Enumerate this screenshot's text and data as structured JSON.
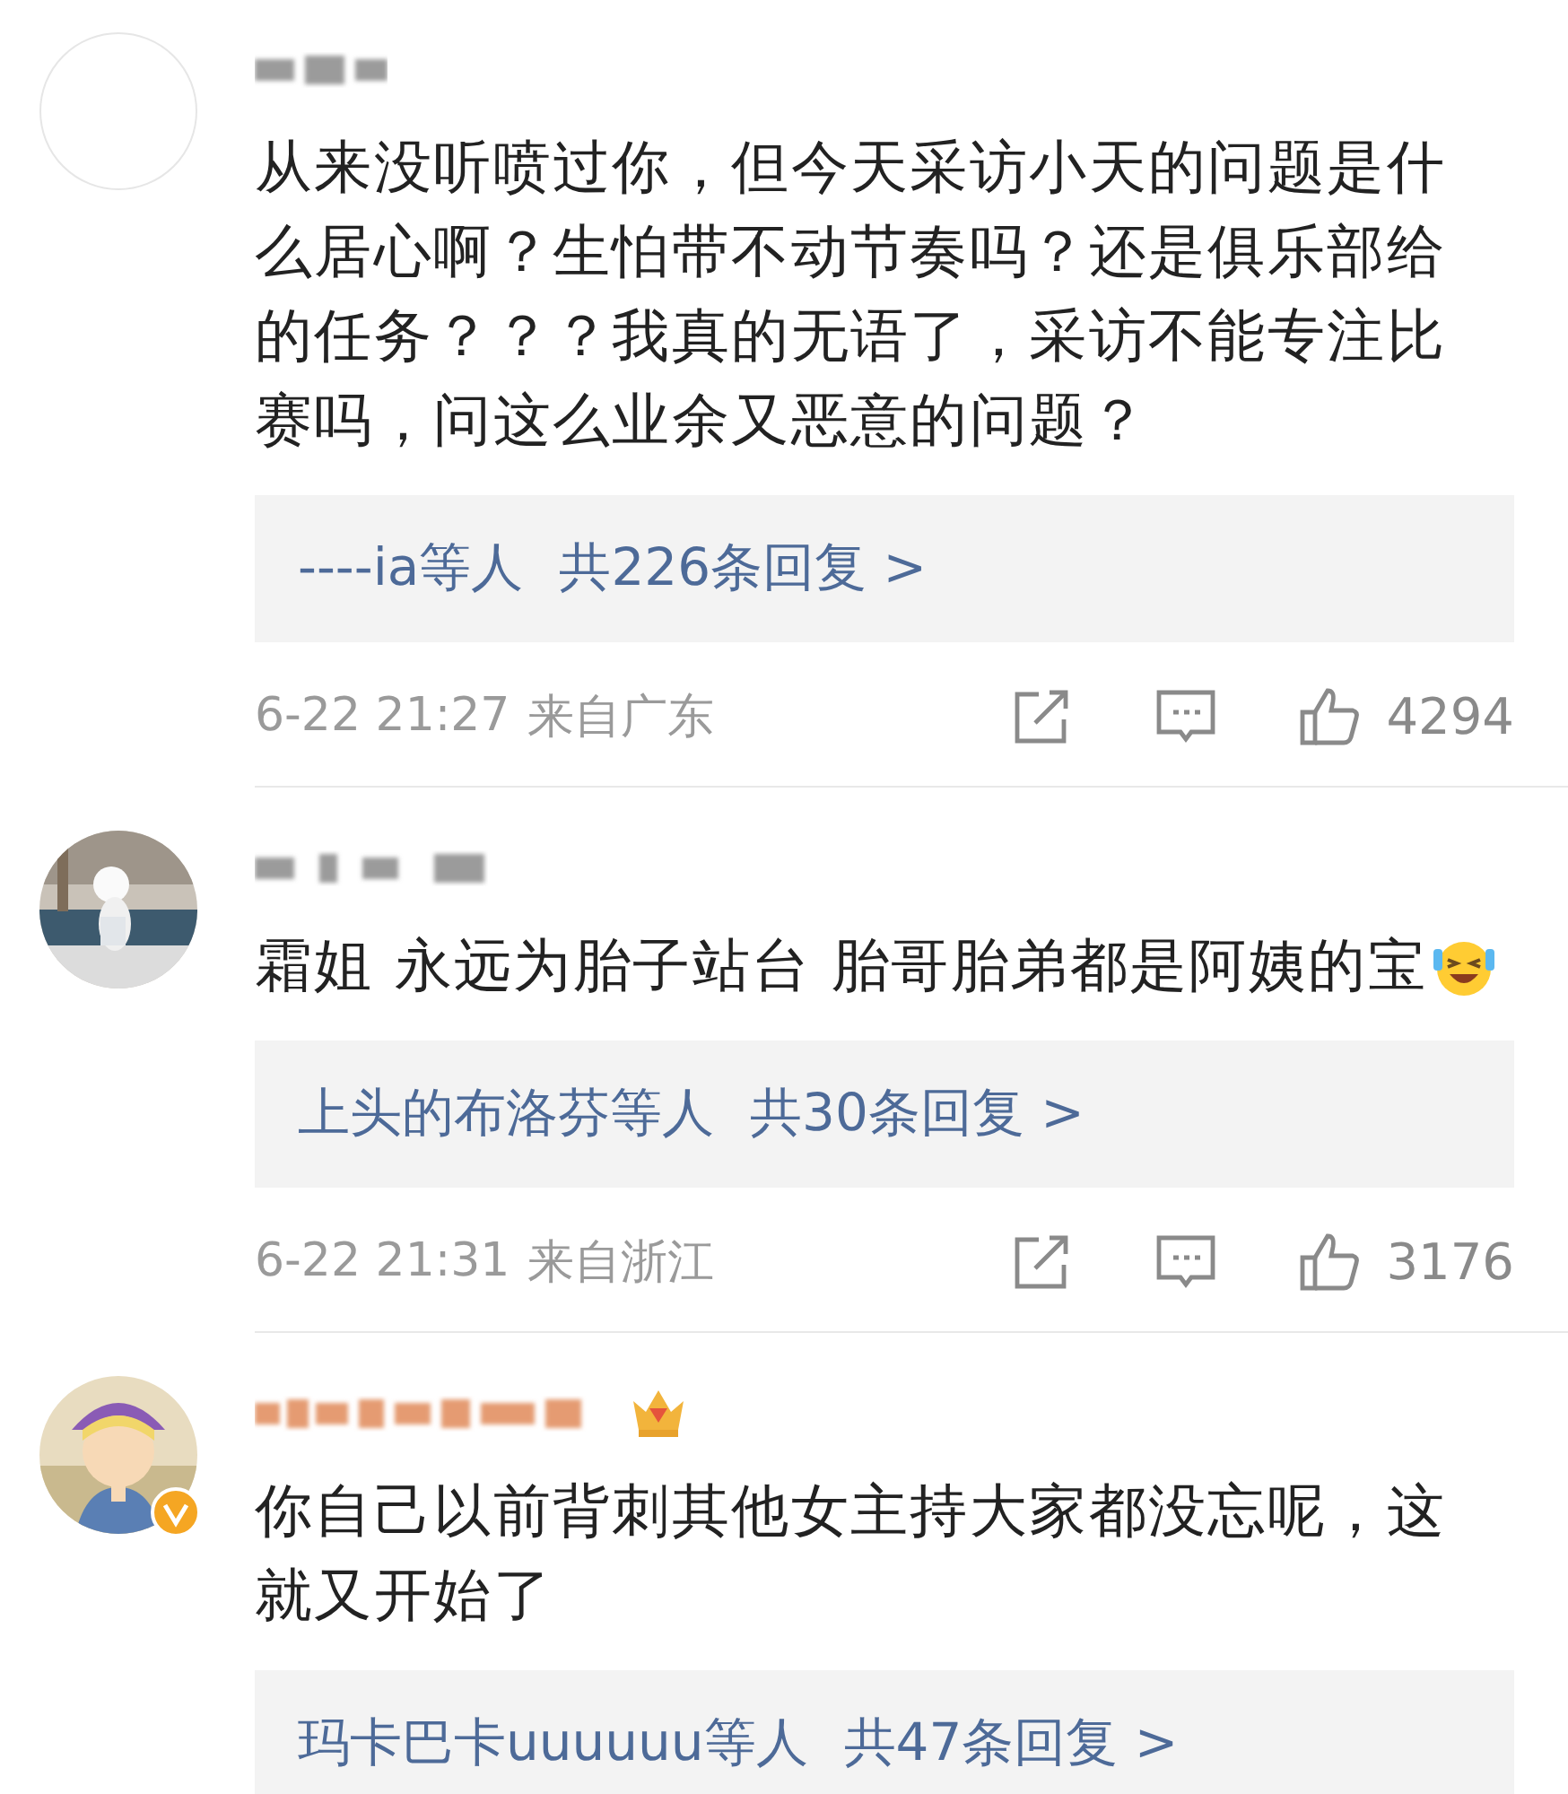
{
  "comments": [
    {
      "avatar": {
        "kind": "blank"
      },
      "vip": false,
      "verified": false,
      "text": "从来没听喷过你，但今天采访小天的问题是什么居心啊？生怕带不动节奏吗？还是俱乐部给的任务？？？我真的无语了，采访不能专注比赛吗，问这么业余又恶意的问题？",
      "emoji": false,
      "replies": {
        "names": "----ia等人",
        "count": "共226条回复 >"
      },
      "date": "6-22 21:27",
      "location": "来自广东",
      "likes": "4294"
    },
    {
      "vip": false,
      "verified": false,
      "text": "霜姐 永远为胎子站台 胎哥胎弟都是阿姨的宝",
      "emoji": true,
      "replies": {
        "names": "上头的布洛芬等人",
        "count": "共30条回复 >"
      },
      "date": "6-22 21:31",
      "location": "来自浙江",
      "likes": "3176"
    },
    {
      "avatar": {
        "kind": "cartoon"
      },
      "vip": true,
      "verified": true,
      "text": "你自己以前背刺其他女主持大家都没忘呢，这就又开始了",
      "emoji": false,
      "replies": {
        "names": "玛卡巴卡uuuuuu等人",
        "count": "共47条回复 >"
      }
    }
  ]
}
